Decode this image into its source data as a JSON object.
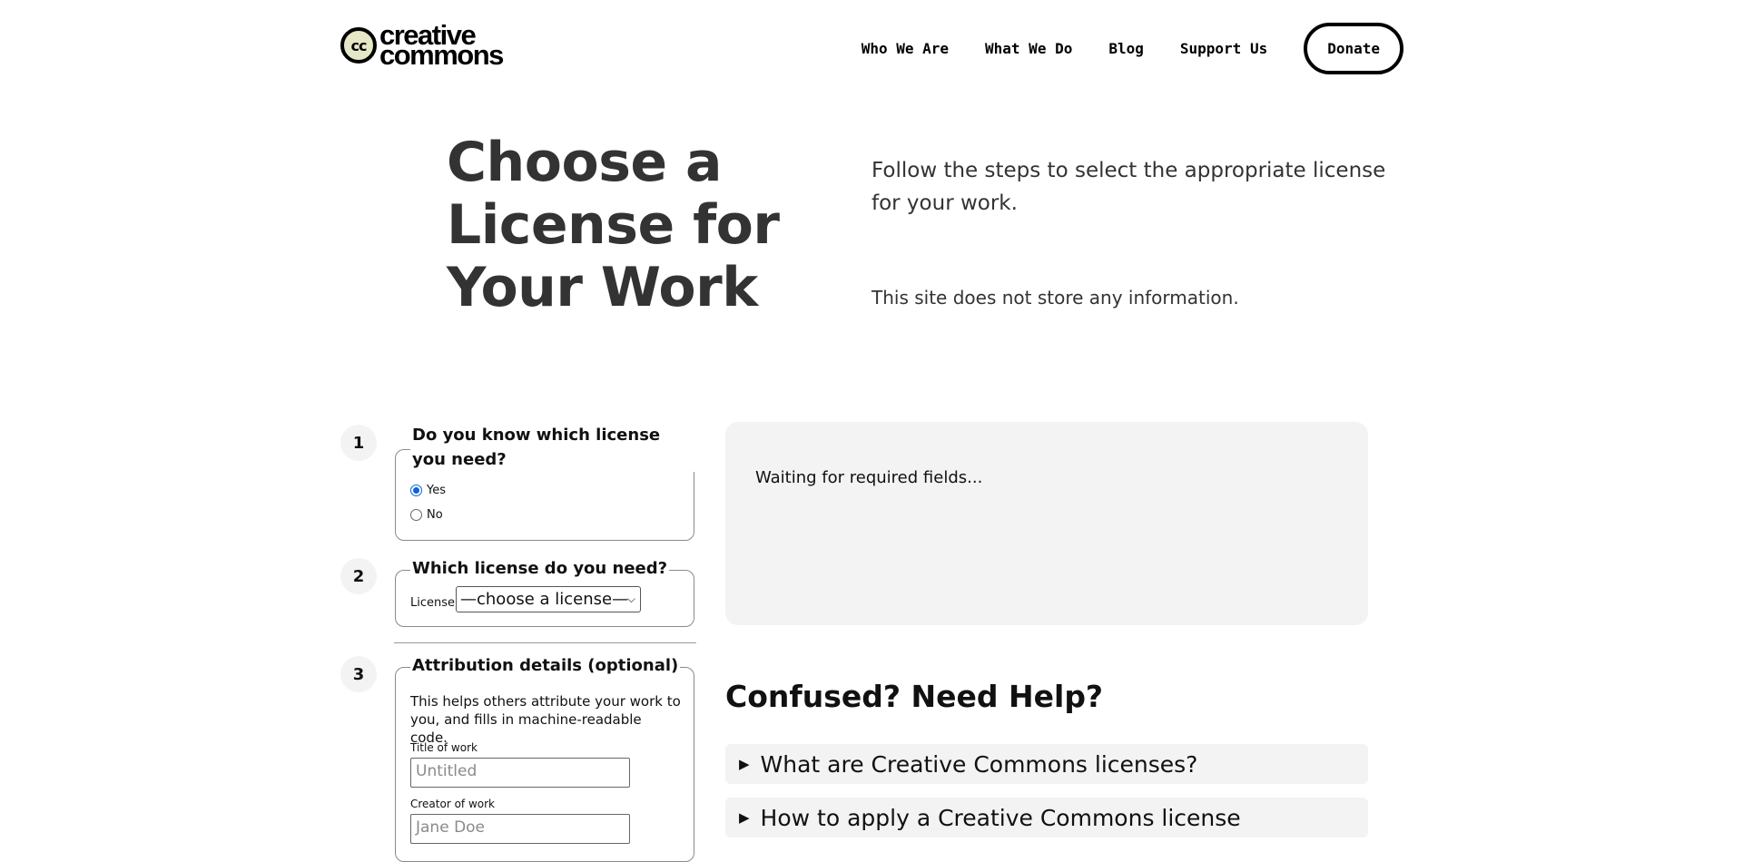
{
  "header": {
    "logo": {
      "line1": "creative",
      "line2": "commons",
      "mark": "cc"
    },
    "nav": [
      "Who We Are",
      "What We Do",
      "Blog",
      "Support Us"
    ],
    "donate": "Donate"
  },
  "hero": {
    "title": "Choose a License for Your Work",
    "lead": "Follow the steps to select the appropriate license for your work.",
    "note": "This site does not store any information."
  },
  "steps": [
    {
      "number": "1",
      "legend": "Do you know which license you need?",
      "options": [
        {
          "label": "Yes",
          "checked": true
        },
        {
          "label": "No",
          "checked": false
        }
      ]
    },
    {
      "number": "2",
      "legend": "Which license do you need?",
      "field_label": "License",
      "select_value": "—choose a license—"
    },
    {
      "number": "3",
      "legend": "Attribution details (optional)",
      "help": "This helps others attribute your work to you, and fills in machine-readable code.",
      "fields": [
        {
          "label": "Title of work",
          "placeholder": "Untitled"
        },
        {
          "label": "Creator of work",
          "placeholder": "Jane Doe"
        }
      ]
    }
  ],
  "panel": {
    "status": "Waiting for required fields..."
  },
  "help": {
    "title": "Confused? Need Help?",
    "items": [
      "What are Creative Commons licenses?",
      "How to apply a Creative Commons license"
    ]
  },
  "colors": {
    "accent_radio": "#0a64d8",
    "panel_bg": "#f3f3f3",
    "text": "#333333"
  }
}
